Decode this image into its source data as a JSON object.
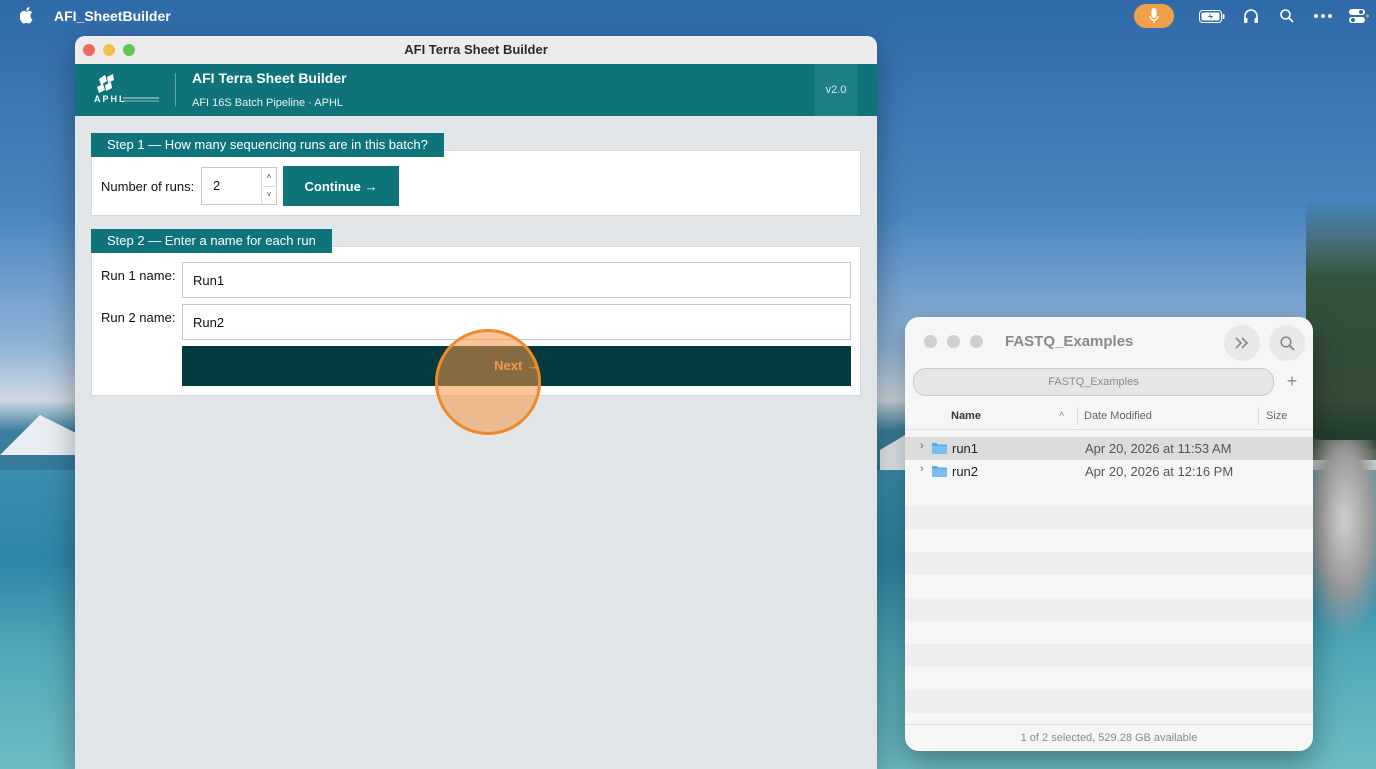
{
  "menubar": {
    "app_name": "AFI_SheetBuilder",
    "icons": [
      "apple-icon",
      "microphone-icon",
      "battery-icon",
      "headphones-icon",
      "search-icon",
      "more-icon",
      "control-center-icon"
    ]
  },
  "app": {
    "window_title": "AFI Terra Sheet Builder",
    "banner_title": "AFI Terra Sheet Builder",
    "banner_subtitle": "AFI 16S Batch Pipeline · APHL",
    "version": "v2.0",
    "logo_text": "APHL",
    "step1": {
      "header": "Step 1 — How many sequencing runs are in this batch?",
      "runs_label": "Number of runs:",
      "runs_value": "2",
      "continue_label": "Continue →"
    },
    "step2": {
      "header": "Step 2 — Enter a name for each run",
      "runs": [
        {
          "label": "Run 1 name:",
          "value": "Run1"
        },
        {
          "label": "Run 2 name:",
          "value": "Run2"
        }
      ],
      "next_label": "Next →"
    }
  },
  "finder": {
    "title": "FASTQ_Examples",
    "path": "FASTQ_Examples",
    "columns": {
      "name": "Name",
      "date": "Date Modified",
      "size": "Size"
    },
    "items": [
      {
        "name": "run1",
        "date": "Apr 20, 2026 at 11:53 AM",
        "selected": true
      },
      {
        "name": "run2",
        "date": "Apr 20, 2026 at 12:16 PM",
        "selected": false
      }
    ],
    "status": "1 of 2 selected, 529.28 GB available"
  },
  "colors": {
    "teal": "#0f7479",
    "dark_teal": "#033a3d",
    "accent_orange": "#f0a04b"
  }
}
